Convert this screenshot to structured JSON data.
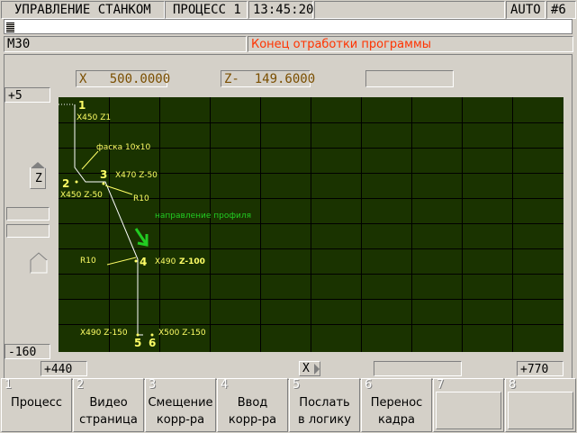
{
  "header": {
    "control_title": "УПРАВЛЕНИЕ СТАНКОМ",
    "process_label": "ПРОЦЕСС 1",
    "time": "13:45:20",
    "mode": "AUTO",
    "channel": "#6"
  },
  "status": {
    "code": "M30",
    "message": "Конец отработки программы"
  },
  "positions": {
    "x": "X   500.0000",
    "z": "Z-  149.6000"
  },
  "scale": {
    "y_top": "+5",
    "y_bottom": "-160",
    "x_left": "+440",
    "x_right": "+770",
    "x_axis_label": "X",
    "z_axis_label": "Z"
  },
  "profile": {
    "point_1": "1",
    "label_1": "X450 Z1",
    "chamfer": "фаска 10x10",
    "point_2": "2",
    "label_2": "X450 Z-50",
    "point_3": "3",
    "label_3": "X470 Z-50",
    "r10_a": "R10",
    "direction": "направление профиля",
    "r10_b": "R10",
    "point_4": "4",
    "label_4a": "X490",
    "label_4b": "Z-100",
    "label_5": "X490 Z-150",
    "point_5": "5",
    "point_6": "6",
    "label_6": "X500 Z-150"
  },
  "fkeys": [
    {
      "num": "1",
      "line1": "Процесс",
      "line2": ""
    },
    {
      "num": "2",
      "line1": "Видео",
      "line2": "страница"
    },
    {
      "num": "3",
      "line1": "Смещение",
      "line2": "корр-ра"
    },
    {
      "num": "4",
      "line1": "Ввод",
      "line2": "корр-ра"
    },
    {
      "num": "5",
      "line1": "Послать",
      "line2": "в логику"
    },
    {
      "num": "6",
      "line1": "Перенос",
      "line2": "кадра"
    },
    {
      "num": "7",
      "line1": "",
      "line2": ""
    },
    {
      "num": "8",
      "line1": "",
      "line2": ""
    }
  ],
  "colors": {
    "background": "#d4d0c8",
    "grid_background": "#1a3300",
    "grid_lines": "#000000",
    "profile": "#ffffff",
    "annotation": "#ffff66",
    "direction_arrow": "#22cc22",
    "message_text": "#ff3300"
  }
}
